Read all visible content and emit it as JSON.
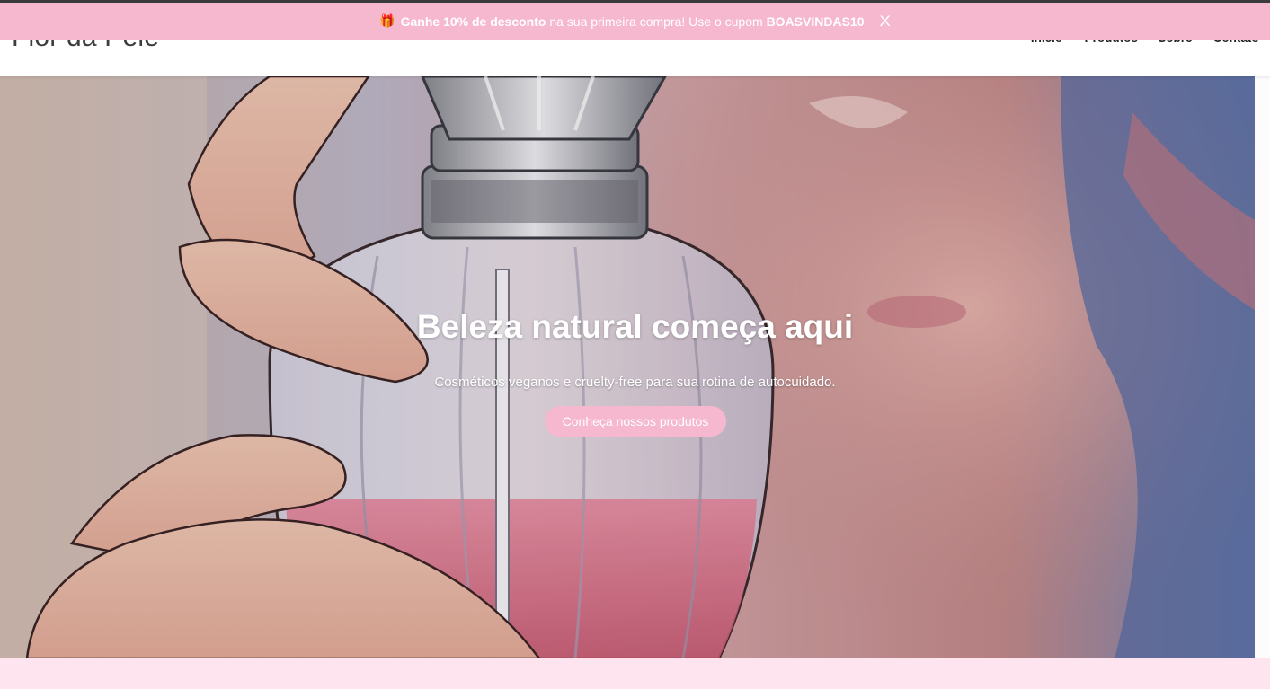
{
  "promo": {
    "gift_icon": "gift-icon",
    "text_before": "Ganhe ",
    "discount": "10% de desconto",
    "text_middle": " na sua primeira compra! Use o cupom ",
    "coupon": "BOASVINDAS10",
    "close_label": "X",
    "background": "#f6b8cf"
  },
  "header": {
    "logo": "Flor da Pele",
    "nav": [
      "Início",
      "Produtos",
      "Sobre",
      "Contato"
    ]
  },
  "hero": {
    "title": "Beleza natural começa aqui",
    "subtitle": "Cosméticos veganos e cruelty-free para sua rotina de autocuidado.",
    "button_label": "Conheça nossos produtos",
    "accent": "#f6b8cf"
  }
}
